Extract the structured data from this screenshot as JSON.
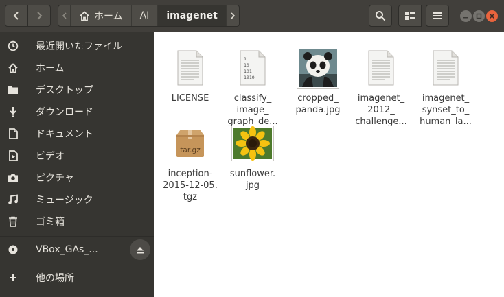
{
  "header": {
    "back_icon": "chevron-left-icon",
    "forward_icon": "chevron-right-icon",
    "breadcrumbs": [
      {
        "label": "ホーム",
        "icon": "home-icon"
      },
      {
        "label": "AI"
      },
      {
        "label": "imagenet"
      }
    ],
    "search_icon": "search-icon",
    "view_icon": "view-options-icon",
    "menu_icon": "hamburger-menu-icon"
  },
  "sidebar": {
    "items": [
      {
        "label": "最近開いたファイル",
        "icon": "recent-icon"
      },
      {
        "label": "ホーム",
        "icon": "home-icon"
      },
      {
        "label": "デスクトップ",
        "icon": "desktop-icon"
      },
      {
        "label": "ダウンロード",
        "icon": "download-icon"
      },
      {
        "label": "ドキュメント",
        "icon": "document-icon"
      },
      {
        "label": "ビデオ",
        "icon": "video-icon"
      },
      {
        "label": "ピクチャ",
        "icon": "camera-icon"
      },
      {
        "label": "ミュージック",
        "icon": "music-icon"
      },
      {
        "label": "ゴミ箱",
        "icon": "trash-icon"
      }
    ],
    "device": {
      "label": "VBox_GAs_...",
      "icon": "disc-icon",
      "eject_icon": "eject-icon"
    },
    "other": {
      "label": "他の場所",
      "icon": "plus-icon"
    }
  },
  "files": [
    {
      "lines": [
        "LICENSE"
      ],
      "icon": "text-file-icon"
    },
    {
      "lines": [
        "classify_",
        "image_",
        "graph_de..."
      ],
      "icon": "binary-file-icon",
      "icon_text": "1\n10\n101\n1010"
    },
    {
      "lines": [
        "cropped_",
        "panda.jpg"
      ],
      "icon": "panda-thumbnail"
    },
    {
      "lines": [
        "imagenet_",
        "2012_",
        "challenge..."
      ],
      "icon": "text-file-icon"
    },
    {
      "lines": [
        "imagenet_",
        "synset_to_",
        "human_la..."
      ],
      "icon": "text-file-icon"
    },
    {
      "lines": [
        "inception-",
        "2015-12-05.",
        "tgz"
      ],
      "icon": "archive-icon",
      "icon_text": "tar.gz"
    },
    {
      "lines": [
        "sunflower.",
        "jpg"
      ],
      "icon": "sunflower-thumbnail"
    }
  ]
}
